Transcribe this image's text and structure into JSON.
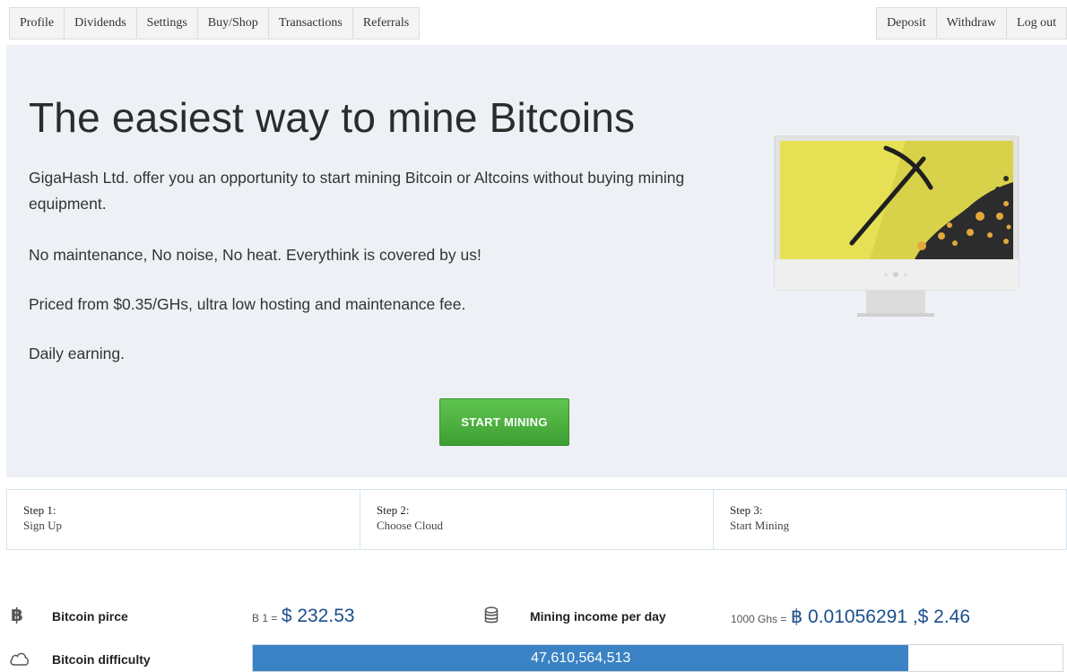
{
  "nav": {
    "left": [
      "Profile",
      "Dividends",
      "Settings",
      "Buy/Shop",
      "Transactions",
      "Referrals"
    ],
    "right": [
      "Deposit",
      "Withdraw",
      "Log out"
    ]
  },
  "hero": {
    "title": "The easiest way to mine Bitcoins",
    "p1": "GigaHash Ltd. offer you an opportunity to start mining Bitcoin or Altcoins without buying mining equipment.",
    "p2": "No maintenance, No noise, No heat. Everythink is covered by us!",
    "p3": "Priced from $0.35/GHs, ultra low hosting and maintenance fee.",
    "p4": "Daily earning.",
    "cta": "START MINING"
  },
  "steps": [
    {
      "num": "Step 1:",
      "text": "Sign Up"
    },
    {
      "num": "Step 2:",
      "text": "Choose Cloud"
    },
    {
      "num": "Step 3:",
      "text": "Start Mining"
    }
  ],
  "stats": {
    "price_label": "Bitcoin pirce",
    "price_prefix": "B 1 =",
    "price_value": "$ 232.53",
    "income_label": "Mining income per day",
    "income_prefix": "1000 Ghs =",
    "income_value": "฿ 0.01056291 ,$ 2.46",
    "difficulty_label": "Bitcoin difficulty",
    "difficulty_value": "47,610,564,513",
    "difficulty_fill": 0.81
  },
  "icons": {
    "bitcoin": "bitcoin-icon",
    "database": "database-icon",
    "cloud": "cloud-icon"
  },
  "colors": {
    "cta": "#4cb33f",
    "bar": "#3a82c4",
    "hero_bg": "#edf1f5",
    "screen": "#e6e055"
  }
}
